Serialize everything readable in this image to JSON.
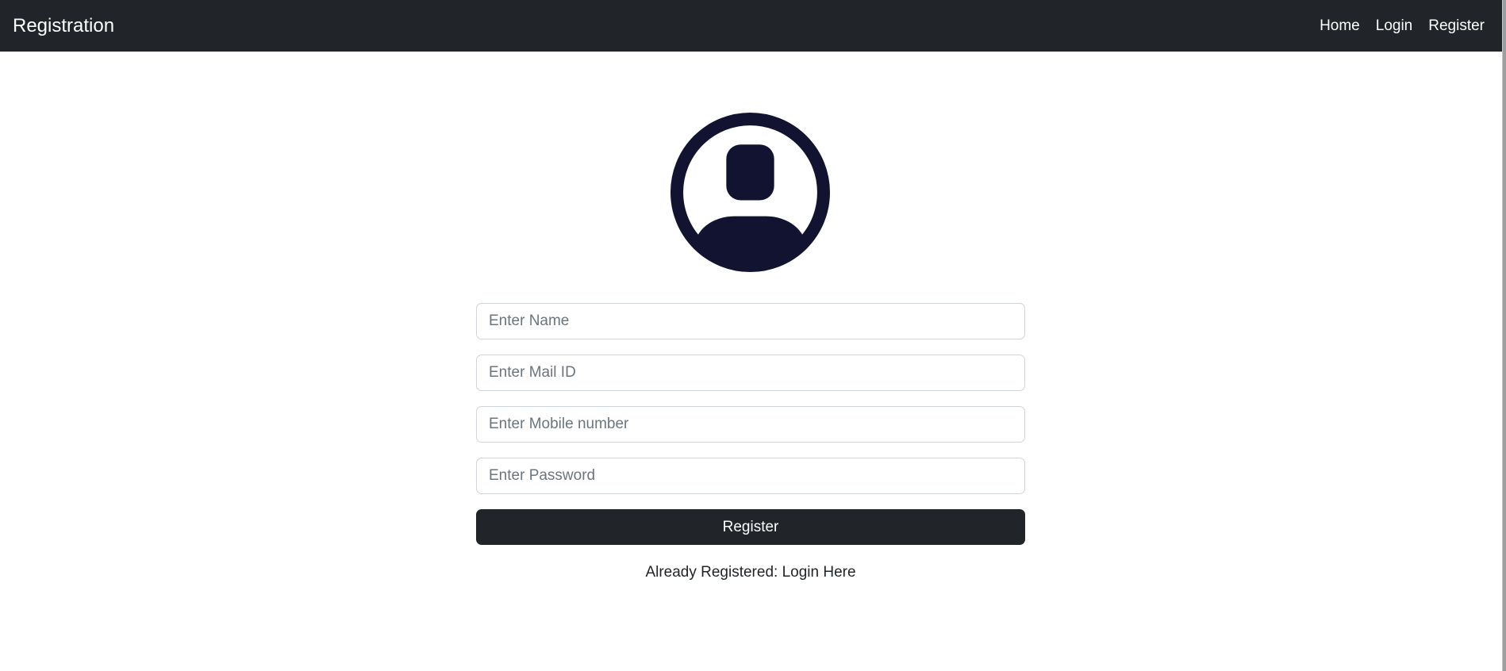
{
  "navbar": {
    "brand": "Registration",
    "links": [
      "Home",
      "Login",
      "Register"
    ]
  },
  "avatar": {
    "icon": "user-circle-icon",
    "color": "#121331"
  },
  "form": {
    "name_placeholder": "Enter Name",
    "mail_placeholder": "Enter Mail ID",
    "mobile_placeholder": "Enter Mobile number",
    "password_placeholder": "Enter Password",
    "submit_label": "Register"
  },
  "footer": {
    "prefix": "Already Registered: ",
    "link_label": "Login Here"
  },
  "colors": {
    "navbar_bg": "#212529",
    "button_bg": "#212529",
    "avatar": "#121331"
  }
}
